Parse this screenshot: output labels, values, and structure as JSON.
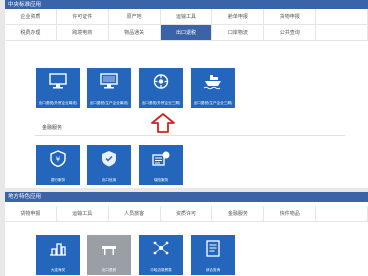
{
  "central": {
    "title": "中央标准应用",
    "tabs": [
      {
        "label": "企业资质"
      },
      {
        "label": "许可证件"
      },
      {
        "label": "原产地"
      },
      {
        "label": "运输工具"
      },
      {
        "label": "舱单申报"
      },
      {
        "label": "货物申报"
      },
      {
        "label": ""
      },
      {
        "label": "税费办理"
      },
      {
        "label": "跨境电商"
      },
      {
        "label": "物品通关"
      },
      {
        "label": "出口退税"
      },
      {
        "label": "口岸物流"
      },
      {
        "label": "公共查询"
      },
      {
        "label": ""
      }
    ],
    "active_tab": "出口退税",
    "tiles": [
      {
        "label": "出口退税(外贸企业离线)"
      },
      {
        "label": "出口退税(生产企业离线)"
      },
      {
        "label": "出口退税(外贸企业三期)"
      },
      {
        "label": "出口退税(生产企业三期)"
      }
    ],
    "finance_label": "金融服务",
    "finance_tiles": [
      {
        "label": "银行服务"
      },
      {
        "label": "出口信用"
      },
      {
        "label": "保险服务"
      }
    ]
  },
  "local": {
    "title": "地方特色应用",
    "tabs": [
      {
        "label": "货物申报"
      },
      {
        "label": "运输工具"
      },
      {
        "label": "人员旅客"
      },
      {
        "label": "资质许可"
      },
      {
        "label": "金融服务"
      },
      {
        "label": "快件物品"
      },
      {
        "label": ""
      }
    ],
    "tiles": [
      {
        "label": "大连海关"
      },
      {
        "label": "出口退税"
      },
      {
        "label": "中哈边境贸易"
      },
      {
        "label": "综合查询"
      }
    ]
  },
  "colors": {
    "brand": "#3a63a8",
    "tile": "#2566bd",
    "arrow": "#d32020"
  }
}
